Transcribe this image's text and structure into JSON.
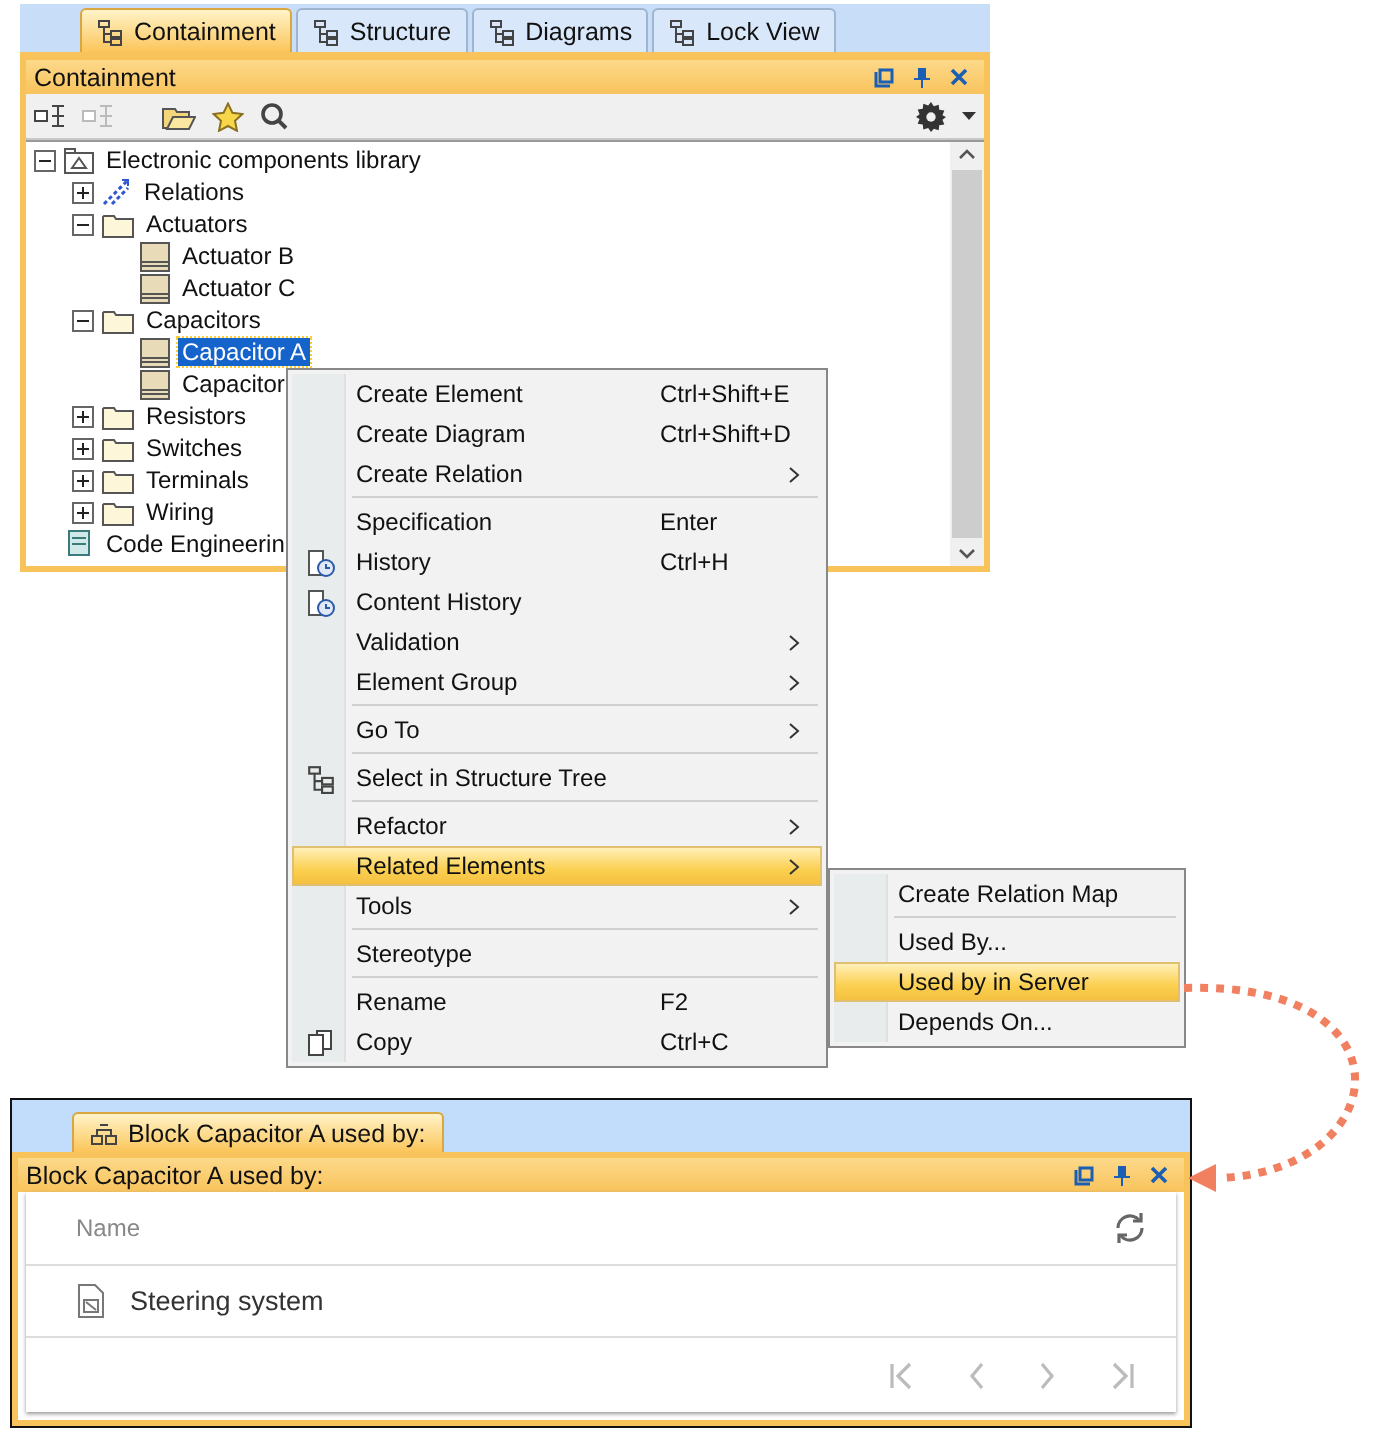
{
  "top_tabs": [
    {
      "label": "Containment",
      "selected": true
    },
    {
      "label": "Structure",
      "selected": false
    },
    {
      "label": "Diagrams",
      "selected": false
    },
    {
      "label": "Lock View",
      "selected": false
    }
  ],
  "containment_panel": {
    "title": "Containment",
    "tree": [
      {
        "label": "Electronic components library",
        "kind": "package",
        "expanded": true,
        "selected": false,
        "children": [
          {
            "label": "Relations",
            "kind": "relations",
            "expanded": false,
            "selected": false
          },
          {
            "label": "Actuators",
            "kind": "folder",
            "expanded": true,
            "selected": false,
            "children": [
              {
                "label": "Actuator B",
                "kind": "block",
                "selected": false
              },
              {
                "label": "Actuator C",
                "kind": "block",
                "selected": false
              }
            ]
          },
          {
            "label": "Capacitors",
            "kind": "folder",
            "expanded": true,
            "selected": false,
            "children": [
              {
                "label": "Capacitor A",
                "kind": "block",
                "selected": true
              },
              {
                "label": "Capacitor",
                "kind": "block",
                "selected": false
              }
            ]
          },
          {
            "label": "Resistors",
            "kind": "folder",
            "expanded": false,
            "selected": false
          },
          {
            "label": "Switches",
            "kind": "folder",
            "expanded": false,
            "selected": false
          },
          {
            "label": "Terminals",
            "kind": "folder",
            "expanded": false,
            "selected": false
          },
          {
            "label": "Wiring",
            "kind": "folder",
            "expanded": false,
            "selected": false
          }
        ]
      },
      {
        "label": "Code Engineerin",
        "kind": "code",
        "selected": false
      }
    ]
  },
  "context_menu": [
    {
      "kind": "item",
      "label": "Create Element",
      "shortcut": "Ctrl+Shift+E",
      "submenu": false,
      "selected": false
    },
    {
      "kind": "item",
      "label": "Create Diagram",
      "shortcut": "Ctrl+Shift+D",
      "submenu": false,
      "selected": false
    },
    {
      "kind": "item",
      "label": "Create Relation",
      "submenu": true,
      "selected": false
    },
    {
      "kind": "separator"
    },
    {
      "kind": "item",
      "label": "Specification",
      "shortcut": "Enter",
      "submenu": false,
      "selected": false
    },
    {
      "kind": "history",
      "label": "History",
      "shortcut": "Ctrl+H",
      "submenu": false,
      "selected": false
    },
    {
      "kind": "history",
      "label": "Content History",
      "submenu": false,
      "selected": false
    },
    {
      "kind": "item",
      "label": "Validation",
      "submenu": true,
      "selected": false
    },
    {
      "kind": "item",
      "label": "Element Group",
      "submenu": true,
      "selected": false
    },
    {
      "kind": "separator"
    },
    {
      "kind": "item",
      "label": "Go To",
      "submenu": true,
      "selected": false
    },
    {
      "kind": "separator"
    },
    {
      "kind": "structure",
      "label": "Select in Structure Tree",
      "submenu": false,
      "selected": false
    },
    {
      "kind": "separator"
    },
    {
      "kind": "item",
      "label": "Refactor",
      "submenu": true,
      "selected": false
    },
    {
      "kind": "item",
      "label": "Related Elements",
      "submenu": true,
      "selected": true
    },
    {
      "kind": "item",
      "label": "Tools",
      "submenu": true,
      "selected": false
    },
    {
      "kind": "separator"
    },
    {
      "kind": "item",
      "label": "Stereotype",
      "submenu": false,
      "selected": false
    },
    {
      "kind": "separator"
    },
    {
      "kind": "item",
      "label": "Rename",
      "shortcut": "F2",
      "submenu": false,
      "selected": false
    },
    {
      "kind": "copy",
      "label": "Copy",
      "shortcut": "Ctrl+C",
      "submenu": false,
      "selected": false
    }
  ],
  "submenu": [
    {
      "kind": "item",
      "label": "Create Relation Map",
      "selected": false
    },
    {
      "kind": "separator"
    },
    {
      "kind": "item",
      "label": "Used By...",
      "selected": false
    },
    {
      "kind": "item",
      "label": "Used by in Server",
      "selected": true
    },
    {
      "kind": "item",
      "label": "Depends On...",
      "selected": false
    }
  ],
  "result_panel": {
    "tab": {
      "label": "Block Capacitor A used by:",
      "selected": true
    },
    "title": "Block Capacitor A used by:",
    "columns": [
      "Name"
    ],
    "rows": [
      {
        "name": "Steering system"
      }
    ]
  }
}
